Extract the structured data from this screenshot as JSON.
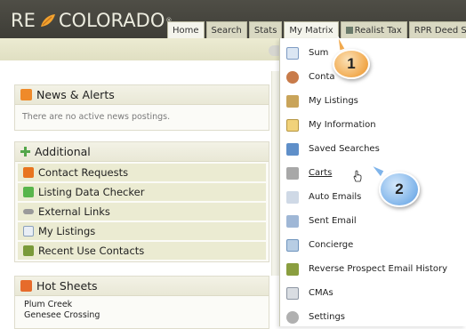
{
  "app": {
    "logo_left": "RE",
    "logo_right": "COLORADO",
    "logo_mark": "®"
  },
  "nav": {
    "tabs": [
      {
        "label": "Home"
      },
      {
        "label": "Search"
      },
      {
        "label": "Stats"
      },
      {
        "label": "My Matrix"
      },
      {
        "label": "Realist Tax"
      },
      {
        "label": "RPR Deed Se"
      }
    ]
  },
  "news": {
    "title": "News & Alerts",
    "empty_text": "There are no active news postings."
  },
  "additional": {
    "title": "Additional",
    "items": [
      {
        "label": "Contact Requests"
      },
      {
        "label": "Listing Data Checker"
      },
      {
        "label": "External Links"
      },
      {
        "label": "My Listings"
      },
      {
        "label": "Recent Use Contacts"
      }
    ]
  },
  "hot_sheets": {
    "title": "Hot Sheets",
    "items": [
      "Plum Creek",
      "Genesee Crossing"
    ]
  },
  "my_matrix_menu": {
    "items": [
      {
        "label": "Sum",
        "icon": "summary-icon"
      },
      {
        "label": "Conta",
        "icon": "contacts-icon"
      },
      {
        "label": "My Listings",
        "icon": "listings-icon"
      },
      {
        "label": "My Information",
        "icon": "information-icon"
      },
      {
        "label": "Saved Searches",
        "icon": "saved-searches-icon"
      },
      {
        "label": "Carts",
        "icon": "cart-icon"
      },
      {
        "label": "Auto Emails",
        "icon": "auto-email-icon"
      },
      {
        "label": "Sent Email",
        "icon": "sent-email-icon"
      },
      {
        "label": "Concierge",
        "icon": "concierge-icon"
      },
      {
        "label": "Reverse Prospect Email History",
        "icon": "reverse-prospect-icon"
      },
      {
        "label": "CMAs",
        "icon": "cma-icon"
      },
      {
        "label": "Settings",
        "icon": "settings-icon"
      }
    ]
  },
  "callouts": {
    "first": "1",
    "second": "2"
  },
  "colors": {
    "header_bg": "#45443d",
    "accent_orange": "#f1a94e",
    "accent_blue": "#7fb4ea",
    "row_bg": "#ebebd2"
  }
}
